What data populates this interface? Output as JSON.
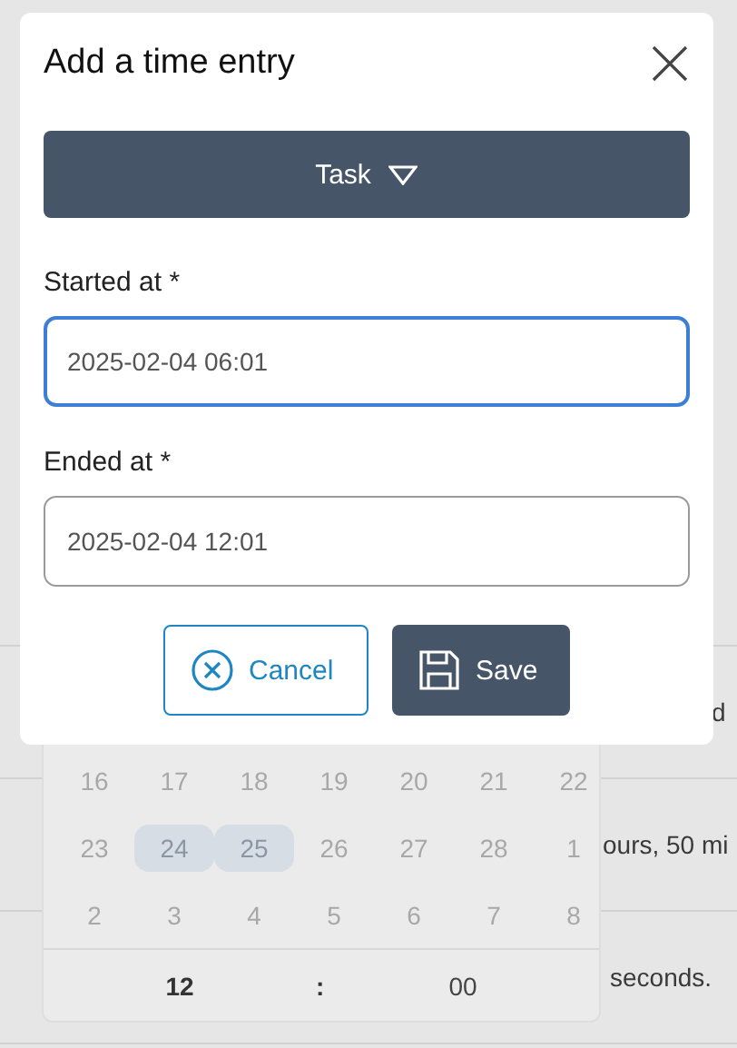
{
  "background_rows": [
    {
      "text": "d"
    },
    {
      "text": "ours, 50 mi"
    },
    {
      "text": "seconds."
    }
  ],
  "dialog": {
    "title": "Add a time entry",
    "task_button": {
      "label": "Task"
    },
    "fields": [
      {
        "label": "Started at *",
        "value": "2025-02-04 06:01",
        "focused": true
      },
      {
        "label": "Ended at *",
        "value": "2025-02-04 12:01",
        "focused": false
      }
    ],
    "buttons": [
      {
        "kind": "cancel",
        "label": "Cancel"
      },
      {
        "kind": "save",
        "label": "Save"
      }
    ]
  },
  "calendar": {
    "weeks": [
      [
        {
          "day": "16",
          "selected": false
        },
        {
          "day": "17",
          "selected": false
        },
        {
          "day": "18",
          "selected": false
        },
        {
          "day": "19",
          "selected": false
        },
        {
          "day": "20",
          "selected": false
        },
        {
          "day": "21",
          "selected": false
        },
        {
          "day": "22",
          "selected": false
        }
      ],
      [
        {
          "day": "23",
          "selected": false
        },
        {
          "day": "24",
          "selected": true
        },
        {
          "day": "25",
          "selected": true
        },
        {
          "day": "26",
          "selected": false
        },
        {
          "day": "27",
          "selected": false
        },
        {
          "day": "28",
          "selected": false
        },
        {
          "day": "1",
          "selected": false
        }
      ],
      [
        {
          "day": "2",
          "selected": false
        },
        {
          "day": "3",
          "selected": false
        },
        {
          "day": "4",
          "selected": false
        },
        {
          "day": "5",
          "selected": false
        },
        {
          "day": "6",
          "selected": false
        },
        {
          "day": "7",
          "selected": false
        },
        {
          "day": "8",
          "selected": false
        }
      ]
    ],
    "hour": "12",
    "separator": ":",
    "minute": "00"
  }
}
